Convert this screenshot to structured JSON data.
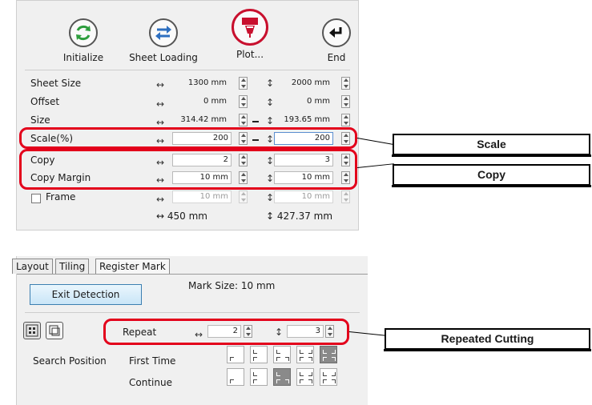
{
  "toolbar": {
    "initialize": "Initialize",
    "sheet_loading": "Sheet Loading",
    "plot": "Plot...",
    "end": "End"
  },
  "settings": {
    "sheet_size": {
      "label": "Sheet Size",
      "w": "1300 mm",
      "h": "2000 mm"
    },
    "offset": {
      "label": "Offset",
      "w": "0 mm",
      "h": "0 mm"
    },
    "size": {
      "label": "Size",
      "w": "314.42 mm",
      "h": "193.65 mm"
    },
    "scale": {
      "label": "Scale(%)",
      "w": "200",
      "h": "200"
    },
    "copy": {
      "label": "Copy",
      "w": "2",
      "h": "3"
    },
    "copy_margin": {
      "label": "Copy Margin",
      "w": "10 mm",
      "h": "10 mm"
    },
    "frame": {
      "label": "Frame",
      "w": "10 mm",
      "h": "10 mm",
      "checked": false
    },
    "total_w": "↔ 450 mm",
    "total_h": "↕ 427.37 mm"
  },
  "callouts": {
    "scale": "Scale",
    "copy": "Copy",
    "repeated_cutting": "Repeated Cutting"
  },
  "register": {
    "tabs": [
      "Layout",
      "Tiling",
      "Register Mark"
    ],
    "exit_detection": "Exit Detection",
    "mark_size": "Mark Size:  10 mm",
    "repeat_label": "Repeat",
    "repeat_w": "2",
    "repeat_h": "3",
    "search_position": "Search Position",
    "first_time": "First Time",
    "continue": "Continue"
  },
  "colors": {
    "highlight": "#e3001b",
    "plot_accent": "#c8102e",
    "refresh": "#2e9e3e",
    "arrows": "#2d6fc0"
  },
  "icons": [
    "refresh-icon",
    "swap-arrows-icon",
    "plot-cutter-icon",
    "return-arrow-icon"
  ]
}
